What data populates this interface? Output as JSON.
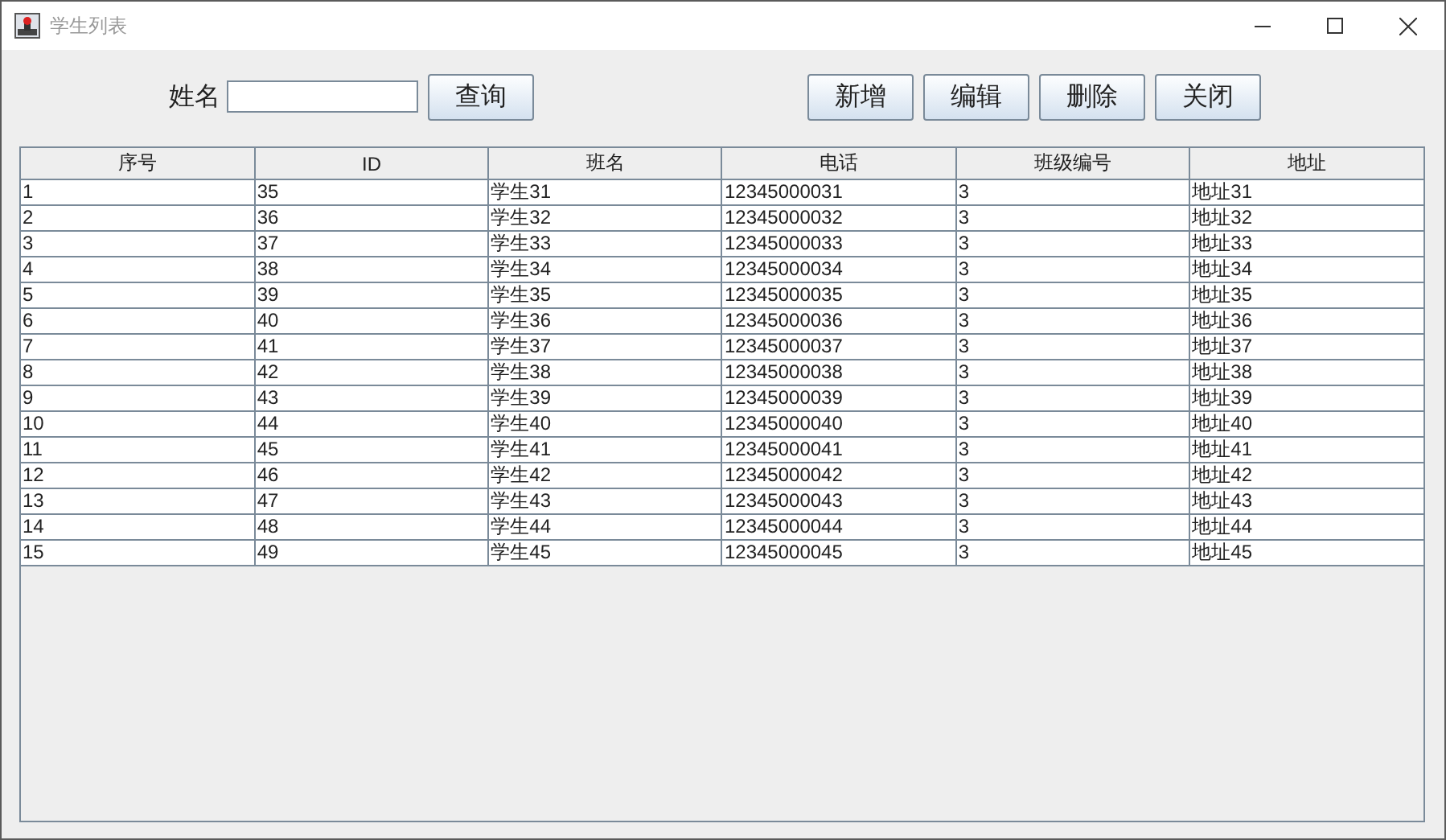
{
  "window": {
    "title": "学生列表"
  },
  "search": {
    "label": "姓名",
    "button": "查询"
  },
  "actions": [
    "新增",
    "编辑",
    "删除",
    "关闭"
  ],
  "table": {
    "columns": [
      "序号",
      "ID",
      "班名",
      "电话",
      "班级编号",
      "地址"
    ],
    "rows": [
      [
        "1",
        "35",
        "学生31",
        "12345000031",
        "3",
        "地址31"
      ],
      [
        "2",
        "36",
        "学生32",
        "12345000032",
        "3",
        "地址32"
      ],
      [
        "3",
        "37",
        "学生33",
        "12345000033",
        "3",
        "地址33"
      ],
      [
        "4",
        "38",
        "学生34",
        "12345000034",
        "3",
        "地址34"
      ],
      [
        "5",
        "39",
        "学生35",
        "12345000035",
        "3",
        "地址35"
      ],
      [
        "6",
        "40",
        "学生36",
        "12345000036",
        "3",
        "地址36"
      ],
      [
        "7",
        "41",
        "学生37",
        "12345000037",
        "3",
        "地址37"
      ],
      [
        "8",
        "42",
        "学生38",
        "12345000038",
        "3",
        "地址38"
      ],
      [
        "9",
        "43",
        "学生39",
        "12345000039",
        "3",
        "地址39"
      ],
      [
        "10",
        "44",
        "学生40",
        "12345000040",
        "3",
        "地址40"
      ],
      [
        "11",
        "45",
        "学生41",
        "12345000041",
        "3",
        "地址41"
      ],
      [
        "12",
        "46",
        "学生42",
        "12345000042",
        "3",
        "地址42"
      ],
      [
        "13",
        "47",
        "学生43",
        "12345000043",
        "3",
        "地址43"
      ],
      [
        "14",
        "48",
        "学生44",
        "12345000044",
        "3",
        "地址44"
      ],
      [
        "15",
        "49",
        "学生45",
        "12345000045",
        "3",
        "地址45"
      ]
    ]
  }
}
